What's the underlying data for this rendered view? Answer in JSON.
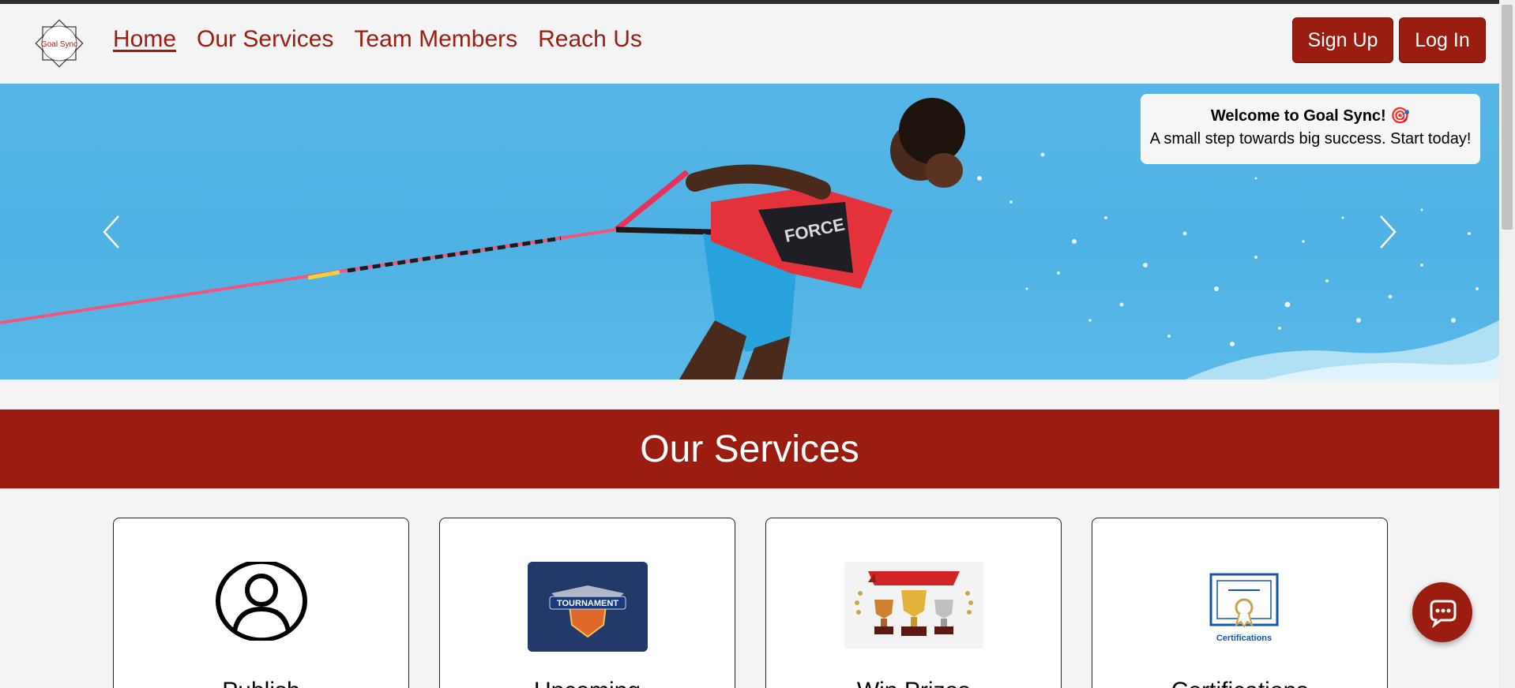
{
  "brand": {
    "logo_text": "Goal Sync"
  },
  "nav": {
    "links": [
      {
        "label": "Home",
        "active": true
      },
      {
        "label": "Our Services",
        "active": false
      },
      {
        "label": "Team Members",
        "active": false
      },
      {
        "label": "Reach Us",
        "active": false
      }
    ],
    "signup_label": "Sign Up",
    "login_label": "Log In"
  },
  "hero": {
    "welcome_title": "Welcome to Goal Sync! 🎯",
    "welcome_subtitle": "A small step towards big success. Start today!",
    "shirt_text": "FORCE",
    "prev_icon": "chevron-left-icon",
    "next_icon": "chevron-right-icon"
  },
  "services": {
    "heading": "Our Services",
    "cards": [
      {
        "title": "Publish",
        "icon": "user-circle-icon"
      },
      {
        "title": "Upcoming",
        "icon": "tournament-badge-image",
        "image_text": "TOURNAMENT"
      },
      {
        "title": "Win Prizes",
        "icon": "trophies-image"
      },
      {
        "title": "Certifications",
        "icon": "certificate-icon",
        "image_text": "Certifications"
      }
    ]
  },
  "chat": {
    "icon": "chat-bubble-icon"
  },
  "colors": {
    "accent": "#9b1d12",
    "sky": "#4fb2e4",
    "background": "#f4f4f4"
  }
}
